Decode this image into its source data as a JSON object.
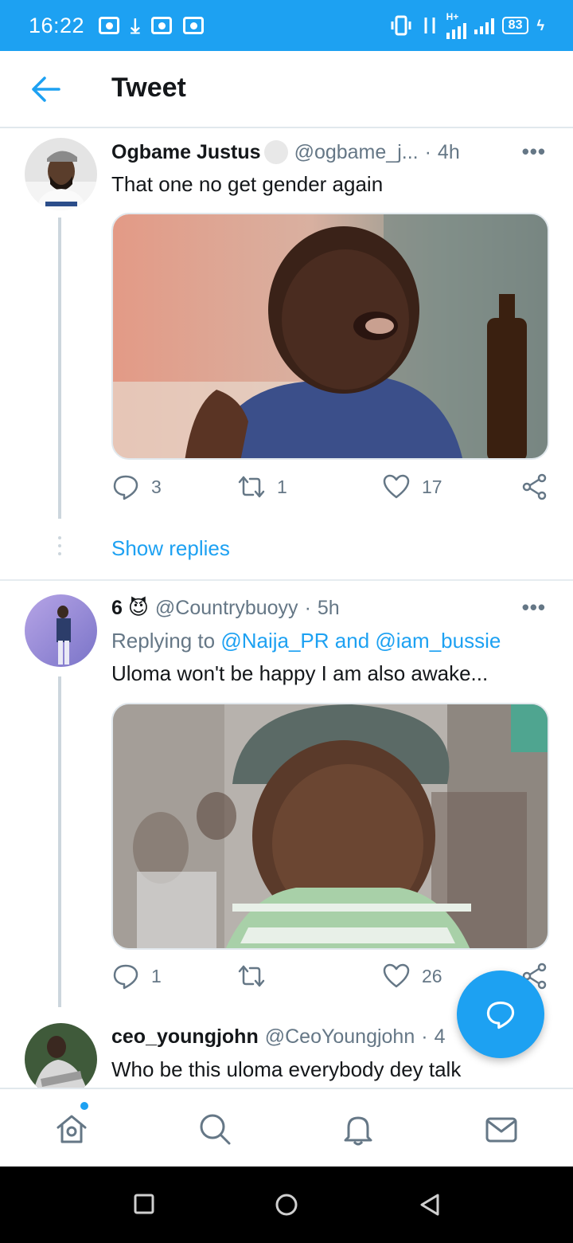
{
  "status_bar": {
    "time": "16:22",
    "network": "H+",
    "battery": "83"
  },
  "header": {
    "title": "Tweet"
  },
  "tweets": [
    {
      "name": "Ogbame Justus",
      "handle": "@ogbame_j...",
      "time": "4h",
      "text": "That one no get gender again",
      "replies": "3",
      "retweets": "1",
      "likes": "17",
      "media_alt": "Child squinting and gesturing with hand, bottle on the right"
    },
    {
      "name": "6 😈",
      "handle": "@Countrybuoyy",
      "time": "5h",
      "replying_prefix": "Replying to",
      "replying_user1": "@Naija_PR",
      "replying_and": "and",
      "replying_user2": "@iam_bussie",
      "text": "Uloma won't be happy I am also awake...",
      "replies": "1",
      "retweets": "",
      "likes": "26",
      "media_alt": "Child in cap and striped shirt looking sideways"
    },
    {
      "name": "ceo_youngjohn",
      "handle": "@CeoYoungjohn",
      "time": "4",
      "text": "Who be this uloma everybody dey talk"
    }
  ],
  "show_replies": "Show replies",
  "colors": {
    "accent": "#1da1f2",
    "text": "#14171a",
    "muted": "#657786"
  },
  "icons": {
    "back": "arrow-left-icon",
    "reply": "reply-icon",
    "retweet": "retweet-icon",
    "like": "heart-icon",
    "share": "share-icon",
    "compose": "compose-reply-icon",
    "home": "home-icon",
    "search": "search-icon",
    "notifications": "bell-icon",
    "messages": "mail-icon"
  }
}
